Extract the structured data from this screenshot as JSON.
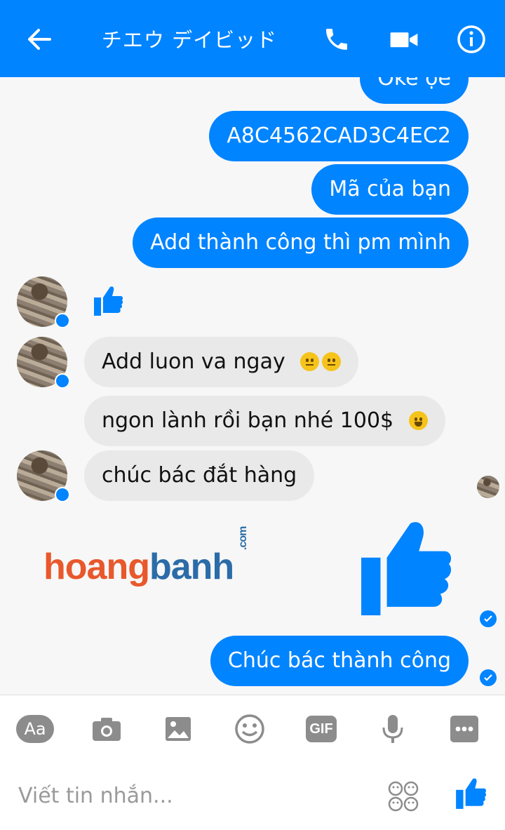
{
  "header": {
    "title": "チエウ デイビッド",
    "back_icon": "arrow-left-icon",
    "call_icon": "phone-icon",
    "video_icon": "video-camera-icon",
    "info_icon": "info-icon",
    "bg_color": "#0084ff"
  },
  "messages": {
    "out_1": "Oke ọe",
    "out_2": "A8C4562CAD3C4EC2",
    "out_3": "Mã của bạn",
    "out_4": "Add thành công thì pm mình",
    "in_1": "Add luon va ngay",
    "in_2": "ngon lành rồi bạn nhé 100$",
    "in_3": "chúc bác  đắt hàng",
    "out_5": "Chúc bác thành công"
  },
  "watermark": {
    "part1": "hoang",
    "part2": "banh",
    "suffix": ".com"
  },
  "composer": {
    "placeholder": "Viết tin nhắn...",
    "tools": [
      "text-format-icon",
      "camera-icon",
      "image-icon",
      "emoji-icon",
      "gif-icon",
      "microphone-icon",
      "more-icon"
    ],
    "gif_label": "GIF",
    "aa_label": "Aa"
  },
  "colors": {
    "accent": "#0084ff",
    "incoming_bubble": "#e9e9e9"
  }
}
